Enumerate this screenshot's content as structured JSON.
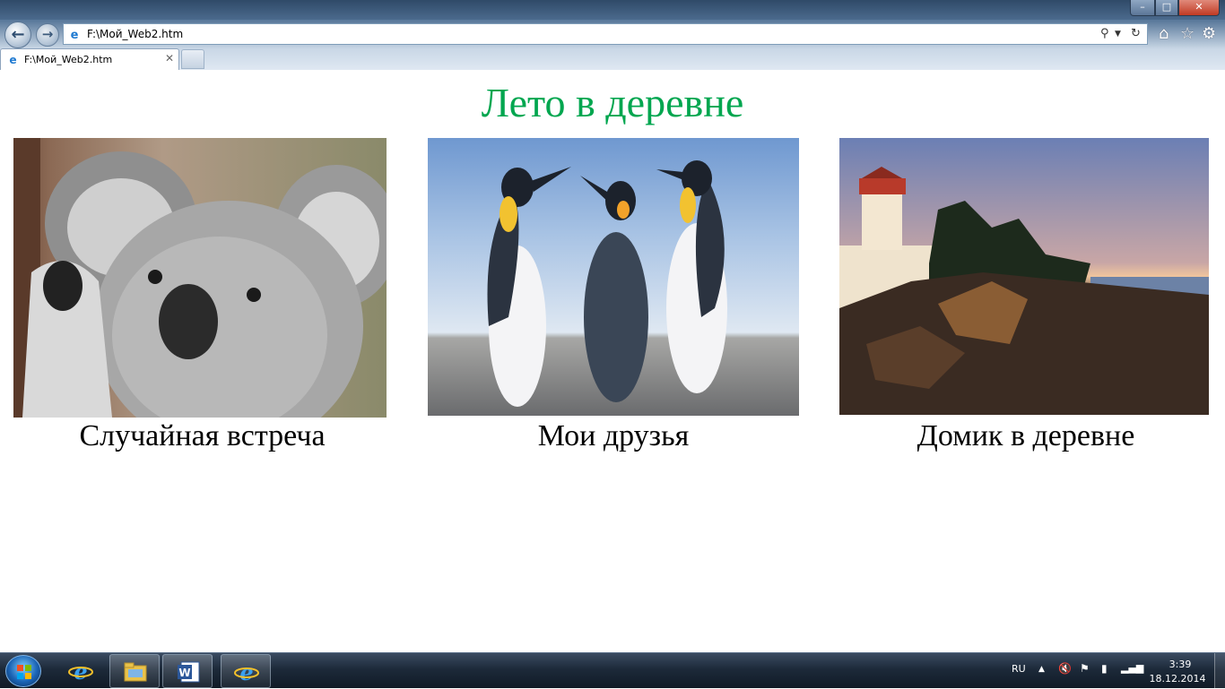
{
  "browser": {
    "window_controls": {
      "minimize": "–",
      "maximize": "□",
      "close": "✕"
    },
    "address": "F:\\Мой_Web2.htm",
    "tab": {
      "label": "F:\\Мой_Web2.htm",
      "close": "✕"
    },
    "icons": [
      "back-arrow-icon",
      "forward-arrow-icon",
      "search-icon",
      "refresh-icon",
      "home-icon",
      "favorites-star-icon",
      "gear-icon"
    ]
  },
  "page": {
    "title": "Лето в деревне",
    "title_color": "#00a64f",
    "photos": [
      {
        "caption": "Случайная встреча",
        "subject": "koala"
      },
      {
        "caption": "Мои друзья",
        "subject": "penguins"
      },
      {
        "caption": "Домик в деревне",
        "subject": "lighthouse"
      }
    ]
  },
  "taskbar": {
    "pinned": [
      "internet-explorer",
      "windows-explorer",
      "microsoft-word",
      "internet-explorer-active"
    ],
    "language": "RU",
    "clock_time": "3:39",
    "clock_date": "18.12.2014"
  }
}
